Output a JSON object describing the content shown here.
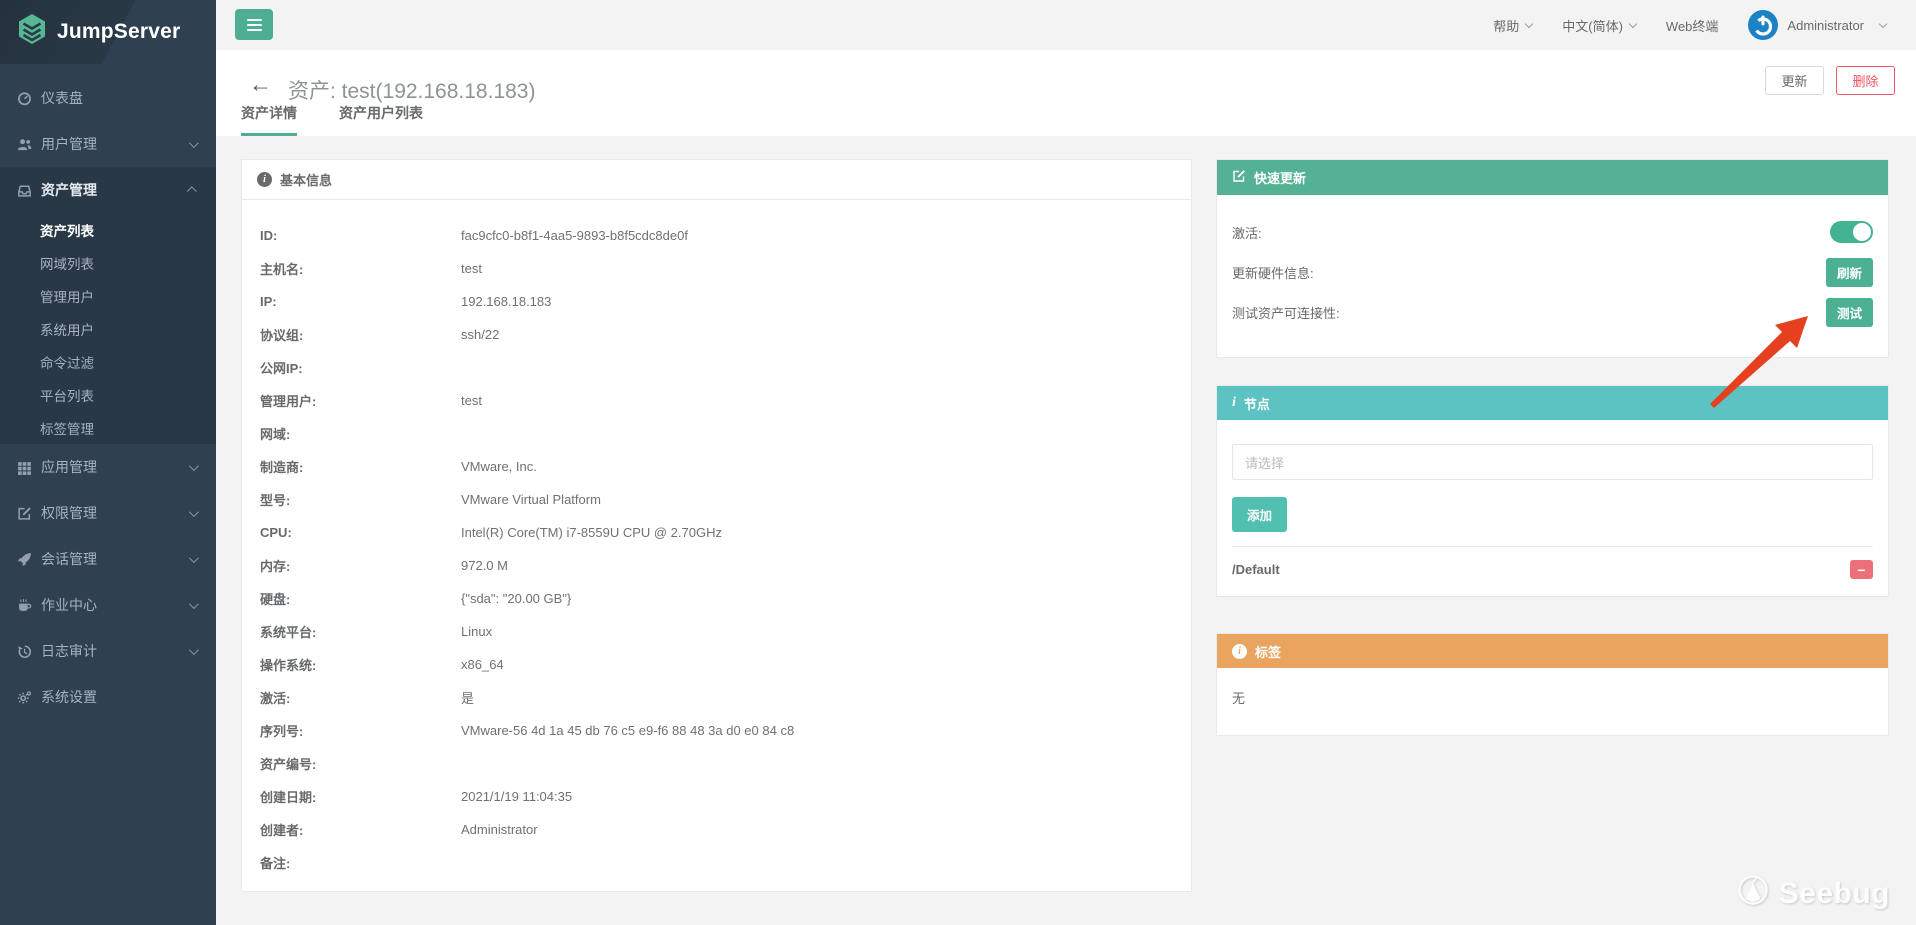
{
  "app": {
    "name": "JumpServer"
  },
  "topbar": {
    "help": "帮助",
    "language": "中文(简体)",
    "web_terminal": "Web终端",
    "user": "Administrator"
  },
  "sidebar": {
    "items": [
      {
        "id": "dashboard",
        "icon": "gauge-icon",
        "label": "仪表盘"
      },
      {
        "id": "user-management",
        "icon": "users-icon",
        "label": "用户管理",
        "chevron": "down"
      },
      {
        "id": "asset-management",
        "icon": "archive-icon",
        "label": "资产管理",
        "chevron": "up",
        "children": [
          {
            "label": "资产列表",
            "active": true
          },
          {
            "label": "网域列表"
          },
          {
            "label": "管理用户"
          },
          {
            "label": "系统用户"
          },
          {
            "label": "命令过滤"
          },
          {
            "label": "平台列表"
          },
          {
            "label": "标签管理"
          }
        ]
      },
      {
        "id": "app-management",
        "icon": "grid-icon",
        "label": "应用管理",
        "chevron": "down"
      },
      {
        "id": "perm-management",
        "icon": "edit-icon",
        "label": "权限管理",
        "chevron": "down"
      },
      {
        "id": "session-management",
        "icon": "rocket-icon",
        "label": "会话管理",
        "chevron": "down"
      },
      {
        "id": "job-center",
        "icon": "coffee-icon",
        "label": "作业中心",
        "chevron": "down"
      },
      {
        "id": "log-audit",
        "icon": "history-icon",
        "label": "日志审计",
        "chevron": "down"
      },
      {
        "id": "system-settings",
        "icon": "gears-icon",
        "label": "系统设置"
      }
    ]
  },
  "page": {
    "title": "资产: test(192.168.18.183)",
    "update_button": "更新",
    "delete_button": "删除",
    "tabs": [
      {
        "label": "资产详情",
        "active": true
      },
      {
        "label": "资产用户列表",
        "active": false
      }
    ]
  },
  "basic_info": {
    "title": "基本信息",
    "rows": [
      {
        "label": "ID:",
        "value": "fac9cfc0-b8f1-4aa5-9893-b8f5cdc8de0f"
      },
      {
        "label": "主机名:",
        "value": "test"
      },
      {
        "label": "IP:",
        "value": "192.168.18.183"
      },
      {
        "label": "协议组:",
        "value": "ssh/22"
      },
      {
        "label": "公网IP:",
        "value": ""
      },
      {
        "label": "管理用户:",
        "value": "test"
      },
      {
        "label": "网域:",
        "value": ""
      },
      {
        "label": "制造商:",
        "value": "VMware, Inc."
      },
      {
        "label": "型号:",
        "value": "VMware Virtual Platform"
      },
      {
        "label": "CPU:",
        "value": "Intel(R) Core(TM) i7-8559U CPU @ 2.70GHz"
      },
      {
        "label": "内存:",
        "value": "972.0 M"
      },
      {
        "label": "硬盘:",
        "value": "{\"sda\": \"20.00 GB\"}"
      },
      {
        "label": "系统平台:",
        "value": "Linux"
      },
      {
        "label": "操作系统:",
        "value": "x86_64"
      },
      {
        "label": "激活:",
        "value": "是"
      },
      {
        "label": "序列号:",
        "value": "VMware-56 4d 1a 45 db 76 c5 e9-f6 88 48 3a d0 e0 84 c8"
      },
      {
        "label": "资产编号:",
        "value": ""
      },
      {
        "label": "创建日期:",
        "value": "2021/1/19 11:04:35"
      },
      {
        "label": "创建者:",
        "value": "Administrator"
      },
      {
        "label": "备注:",
        "value": ""
      }
    ]
  },
  "quick_update": {
    "title": "快速更新",
    "rows": [
      {
        "label": "激活:",
        "control": "toggle",
        "state": "on"
      },
      {
        "label": "更新硬件信息:",
        "button": "刷新"
      },
      {
        "label": "测试资产可连接性:",
        "button": "测试"
      }
    ]
  },
  "node_panel": {
    "title": "节点",
    "select_placeholder": "请选择",
    "add_button": "添加",
    "node": "/Default"
  },
  "label_panel": {
    "title": "标签",
    "empty": "无"
  },
  "watermark": {
    "text": "Seebug"
  },
  "colors": {
    "primary_green": "#4cb092",
    "header_green": "#54b193",
    "header_teal": "#5cc2c2",
    "header_orange": "#e9a55f",
    "danger_red": "#ed5565",
    "sidebar_bg": "#2f4050",
    "arrow_red": "#e5401f"
  }
}
